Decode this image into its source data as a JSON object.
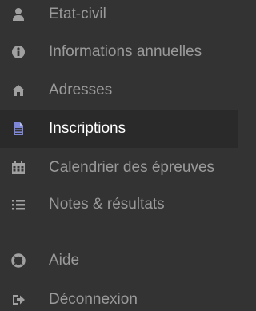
{
  "colors": {
    "background": "#333333",
    "active_background": "#2a2a2a",
    "text": "#9a9a9a",
    "active_text": "#ffffff",
    "icon": "#a0a0a0",
    "active_icon": "#7e86d8"
  },
  "menu": {
    "items": [
      {
        "label": "Etat-civil",
        "icon": "user-icon",
        "active": false
      },
      {
        "label": "Informations annuelles",
        "icon": "info-circle-icon",
        "active": false
      },
      {
        "label": "Adresses",
        "icon": "home-icon",
        "active": false
      },
      {
        "label": "Inscriptions",
        "icon": "document-icon",
        "active": true
      },
      {
        "label": "Calendrier des épreuves",
        "icon": "calendar-icon",
        "active": false
      },
      {
        "label": "Notes & résultats",
        "icon": "list-icon",
        "active": false
      },
      {
        "label": "Aide",
        "icon": "lifebuoy-icon",
        "active": false
      },
      {
        "label": "Déconnexion",
        "icon": "sign-out-icon",
        "active": false
      }
    ]
  }
}
